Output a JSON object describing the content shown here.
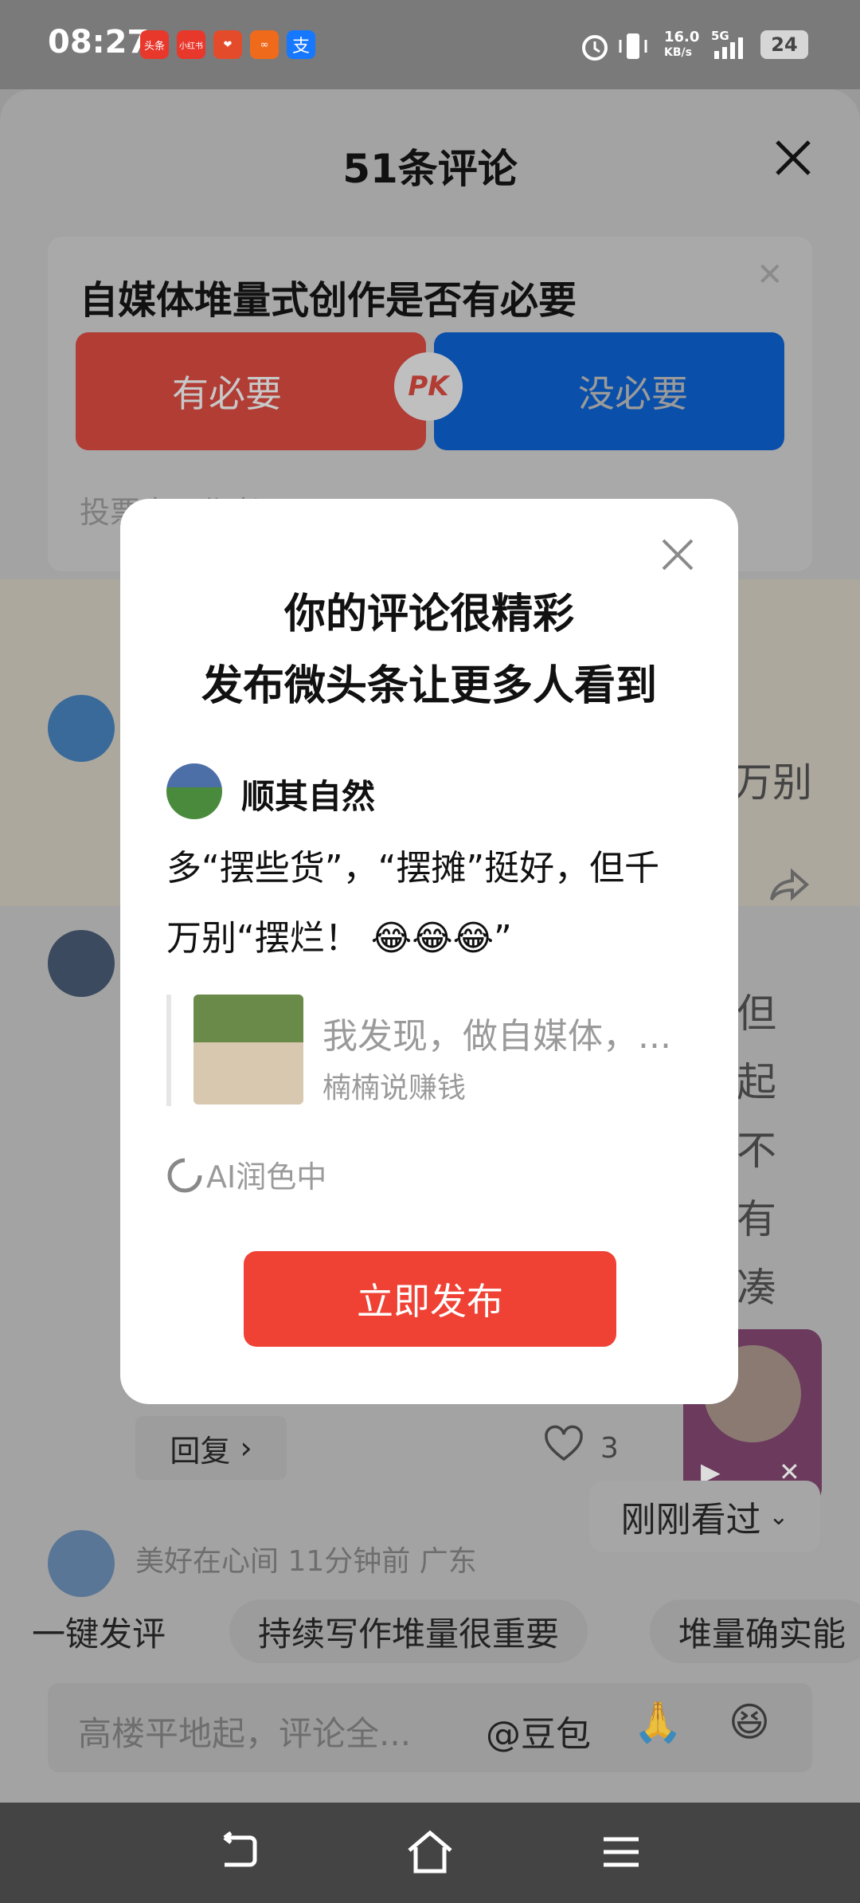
{
  "status_bar": {
    "time": "08:27",
    "apps": [
      {
        "icon": "toutiao-icon",
        "label": "头条",
        "color": "#e8382c"
      },
      {
        "icon": "xiaohongshu-icon",
        "label": "小红书",
        "color": "#e8382c"
      },
      {
        "icon": "game-icon",
        "label": "",
        "color": "#e44b2b"
      },
      {
        "icon": "app-orange-icon",
        "label": "",
        "color": "#f06a1c"
      },
      {
        "icon": "alipay-icon",
        "label": "支",
        "color": "#1677ff"
      }
    ],
    "net_speed": "16.0",
    "net_unit": "KB/s",
    "network": "5G",
    "battery": "24"
  },
  "sheet": {
    "title": "51条评论",
    "pk": {
      "question": "自媒体堆量式创作是否有必要",
      "yes_label": "有必要",
      "no_label": "没必要",
      "badge": "PK",
      "footer": "投票中 | 作者"
    },
    "bg_comments": [
      {
        "text_tail": "万别"
      },
      {
        "text_tail": [
          "但",
          "起",
          "不",
          "有",
          "凑"
        ]
      }
    ],
    "reply_label": "回复",
    "like_count": "3",
    "third_comment_meta": "美好在心间  11分钟前  广东",
    "chips": [
      "一键发评",
      "持续写作堆量很重要",
      "堆量确实能"
    ],
    "input_placeholder": "高楼平地起，评论全...",
    "at_label": "@豆包",
    "recent_viewed": "刚刚看过"
  },
  "dialog": {
    "title_line1": "你的评论很精彩",
    "title_line2": "发布微头条让更多人看到",
    "user": "顺其自然",
    "comment_line1": "多“摆些货”，“摆摊”挺好，但千",
    "comment_line2": "万别“摆烂！ 😂😂😂”",
    "quote_text": "我发现，做自媒体，...",
    "quote_author": "楠楠说赚钱",
    "ai_status": "AI润色中",
    "publish_label": "立即发布"
  }
}
